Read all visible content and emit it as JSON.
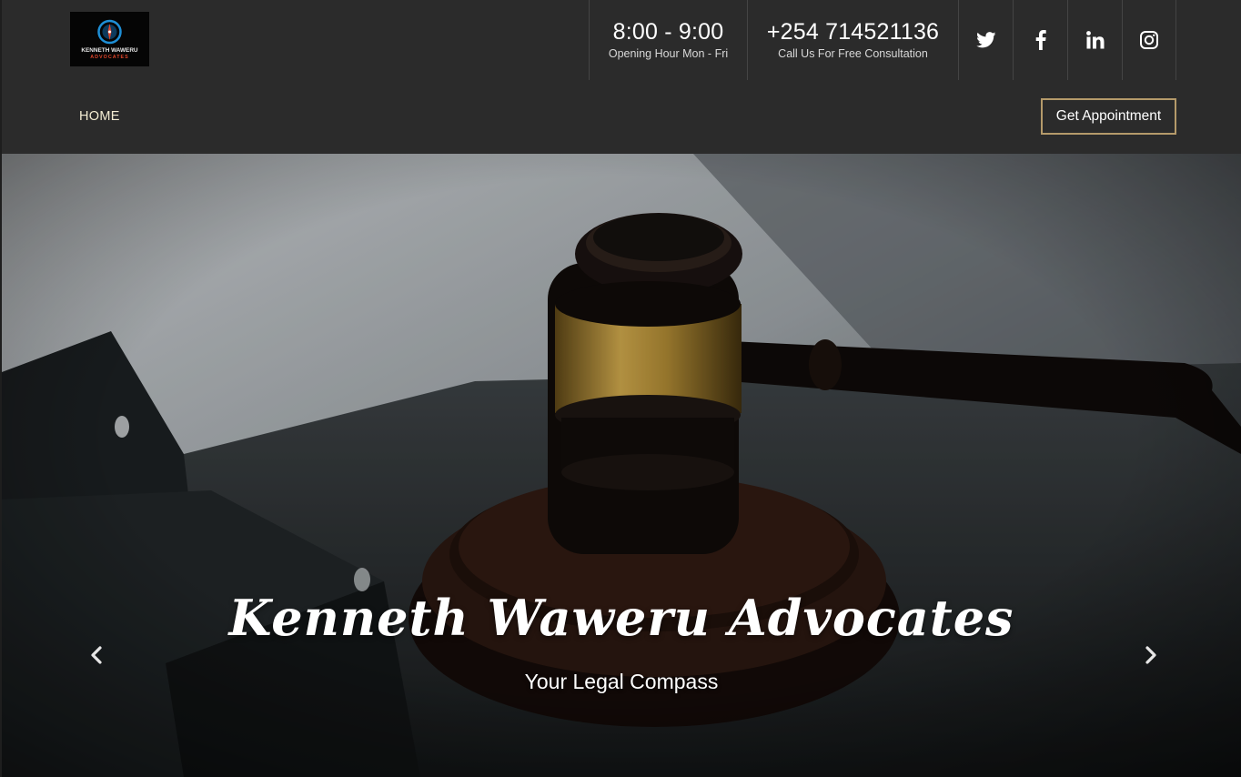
{
  "brand": {
    "logo_name": "KENNETH WAWERU",
    "logo_sub": "ADVOCATES"
  },
  "header": {
    "hours_main": "8:00 - 9:00",
    "hours_sub": "Opening Hour Mon - Fri",
    "phone_main": "+254 714521136",
    "phone_sub": "Call Us For Free Consultation",
    "social": [
      "twitter-icon",
      "facebook-icon",
      "linkedin-icon",
      "instagram-icon"
    ]
  },
  "nav": {
    "home": "HOME",
    "appointment": "Get Appointment"
  },
  "hero": {
    "title": "Kenneth Waweru Advocates",
    "subtitle": "Your Legal Compass",
    "prev_icon": "chevron-left-icon",
    "next_icon": "chevron-right-icon"
  },
  "colors": {
    "background": "#2b2b2b",
    "accent": "#b59a6a",
    "nav_text": "#f3ecd2"
  }
}
